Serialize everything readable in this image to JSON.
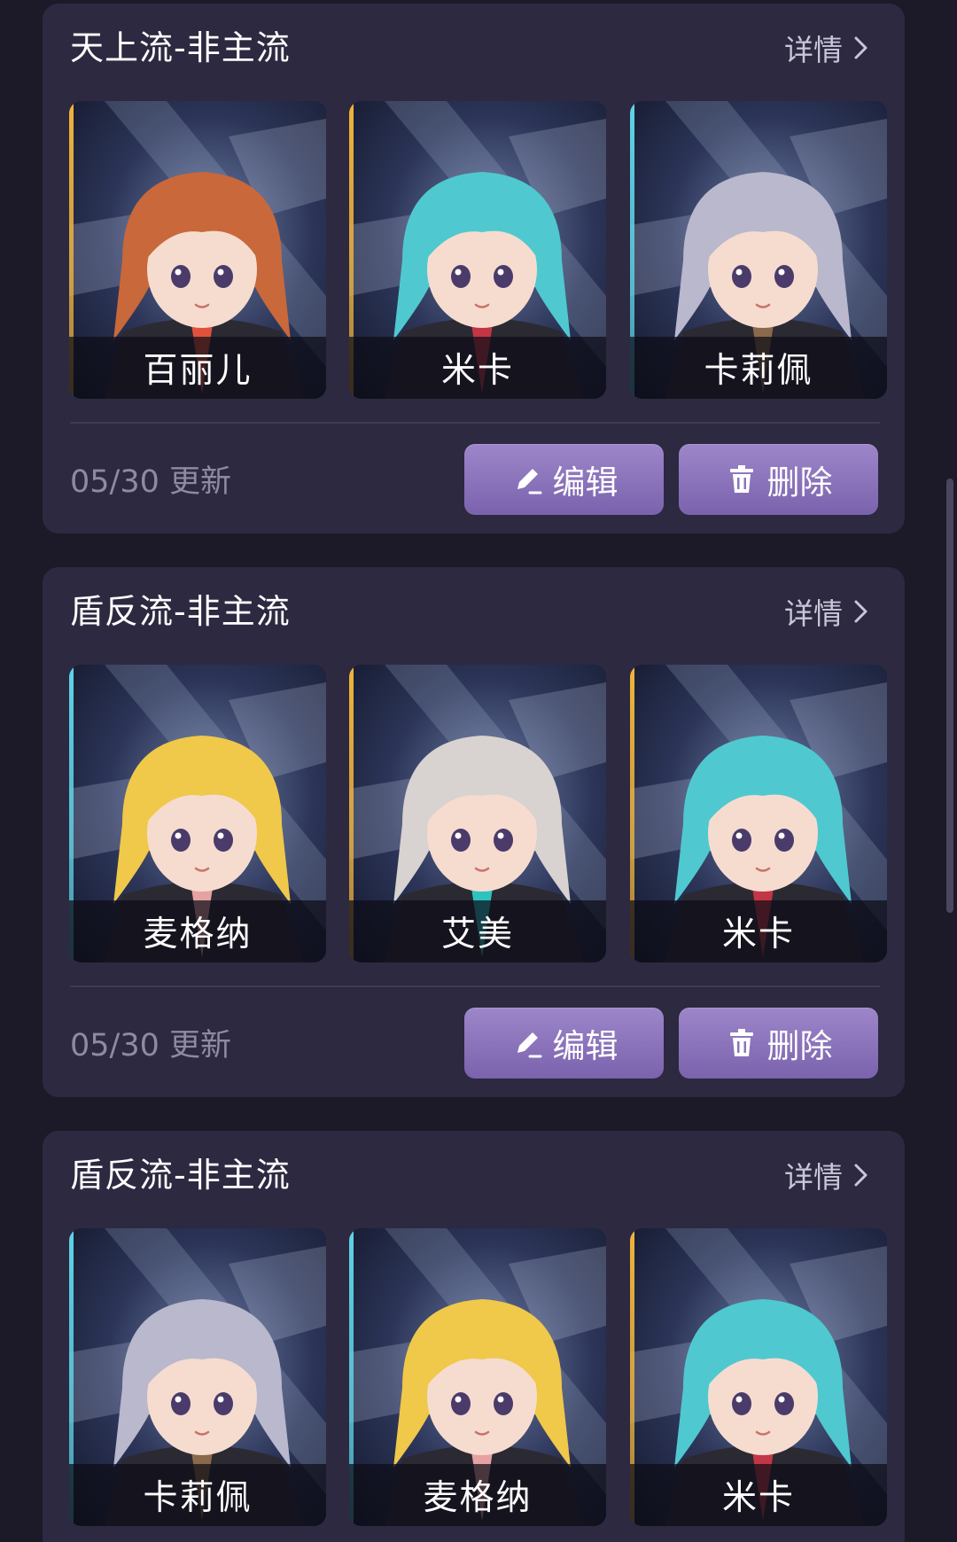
{
  "cards": [
    {
      "title": "天上流-非主流",
      "details_label": "详情",
      "updated": "05/30 更新",
      "edit_label": "编辑",
      "delete_label": "删除",
      "heroes": [
        {
          "name": "百丽儿",
          "rarity_color": "#f0b43c",
          "hair_color": "#c9683a",
          "accent": "#e0523c"
        },
        {
          "name": "米卡",
          "rarity_color": "#f0b43c",
          "hair_color": "#4fc9cf",
          "accent": "#c23645"
        },
        {
          "name": "卡莉佩",
          "rarity_color": "#5fd4e8",
          "hair_color": "#b9b8cc",
          "accent": "#8a6a4a"
        }
      ]
    },
    {
      "title": "盾反流-非主流",
      "details_label": "详情",
      "updated": "05/30 更新",
      "edit_label": "编辑",
      "delete_label": "删除",
      "heroes": [
        {
          "name": "麦格纳",
          "rarity_color": "#5fd4e8",
          "hair_color": "#f0c84a",
          "accent": "#e6a2a2"
        },
        {
          "name": "艾美",
          "rarity_color": "#f0b43c",
          "hair_color": "#d8d2d0",
          "accent": "#2ec3c0"
        },
        {
          "name": "米卡",
          "rarity_color": "#f0b43c",
          "hair_color": "#4fc9cf",
          "accent": "#c23645"
        }
      ]
    },
    {
      "title": "盾反流-非主流",
      "details_label": "详情",
      "updated": "",
      "edit_label": "",
      "delete_label": "",
      "heroes": [
        {
          "name": "卡莉佩",
          "rarity_color": "#5fd4e8",
          "hair_color": "#b9b8cc",
          "accent": "#8a6a4a"
        },
        {
          "name": "麦格纳",
          "rarity_color": "#5fd4e8",
          "hair_color": "#f0c84a",
          "accent": "#e6a2a2"
        },
        {
          "name": "米卡",
          "rarity_color": "#f0b43c",
          "hair_color": "#4fc9cf",
          "accent": "#c23645"
        }
      ]
    }
  ],
  "icons": {
    "details": "chevron-right-icon",
    "edit": "pencil-icon",
    "delete": "trash-icon"
  },
  "colors": {
    "background": "#1c1a29",
    "card": "#2c2940",
    "button": "#8b74bc",
    "title": "#ffffff",
    "muted": "#8e8aa4"
  }
}
